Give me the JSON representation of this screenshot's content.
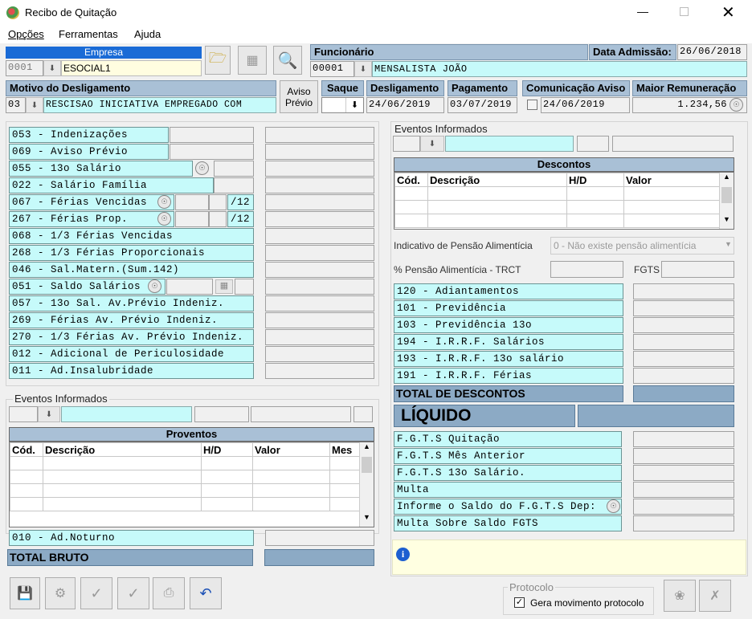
{
  "window": {
    "title": "Recibo de Quitação"
  },
  "menu": [
    "Opções",
    "Ferramentas",
    "Ajuda"
  ],
  "empresa": {
    "label": "Empresa",
    "code": "0001",
    "name": "ESOCIAL1"
  },
  "funcionario": {
    "label": "Funcionário",
    "code": "00001",
    "name": "MENSALISTA JOÃO"
  },
  "admissao": {
    "label": "Data Admissão:",
    "value": "26/06/2018"
  },
  "motivo": {
    "label": "Motivo do Desligamento",
    "code": "03",
    "value": "RESCISAO INICIATIVA EMPREGADO COM"
  },
  "aviso_previo": {
    "line1": "Aviso",
    "line2": "Prévio"
  },
  "saque": {
    "label": "Saque"
  },
  "desligamento": {
    "label": "Desligamento",
    "value": "24/06/2019"
  },
  "pagamento": {
    "label": "Pagamento",
    "value": "03/07/2019"
  },
  "comunicacao": {
    "label": "Comunicação Aviso",
    "value": "24/06/2019"
  },
  "maior_rem": {
    "label": "Maior Remuneração",
    "value": "1.234,56"
  },
  "left_events": [
    {
      "text": "053 - Indenizações"
    },
    {
      "text": "069 - Aviso Prévio"
    },
    {
      "text": "055 - 13o Salário"
    },
    {
      "text": "022 - Salário Família"
    },
    {
      "text": "067 - Férias Vencidas",
      "suffix": "/12"
    },
    {
      "text": "267 - Férias Prop.",
      "suffix": "/12"
    },
    {
      "text": "068 - 1/3 Férias Vencidas"
    },
    {
      "text": "268 - 1/3 Férias Proporcionais"
    },
    {
      "text": "046 - Sal.Matern.(Sum.142)"
    },
    {
      "text": "051 - Saldo Salários"
    },
    {
      "text": "057 - 13o Sal. Av.Prévio Indeniz."
    },
    {
      "text": "269 -  Férias  Av. Prévio Indeniz."
    },
    {
      "text": "270 - 1/3 Férias Av. Prévio Indeniz."
    },
    {
      "text": "012 - Adicional de Periculosidade"
    },
    {
      "text": "011 - Ad.Insalubridade"
    }
  ],
  "eventos_informados_label": "Eventos Informados",
  "proventos": {
    "title": "Proventos",
    "cols": [
      "Cód.",
      "Descrição",
      "H/D",
      "Valor",
      "Mes"
    ]
  },
  "ad_noturno": "010 - Ad.Noturno",
  "total_bruto": "TOTAL BRUTO",
  "descontos": {
    "title": "Descontos",
    "cols": [
      "Cód.",
      "Descrição",
      "H/D",
      "Valor"
    ]
  },
  "pensao": {
    "label": "Indicativo de Pensão Alimentícia",
    "value": "0 - Não existe pensão alimentícia"
  },
  "pct_pensao": {
    "label": "% Pensão Alimentícia - TRCT"
  },
  "fgts_label": "FGTS",
  "desc_events": [
    "120 - Adiantamentos",
    "101 - Previdência",
    "103 - Previdência 13o",
    "194 - I.R.R.F. Salários",
    "193 - I.R.R.F. 13o salário",
    "191 - I.R.R.F. Férias"
  ],
  "total_descontos": "TOTAL DE DESCONTOS",
  "liquido": "LÍQUIDO",
  "fgts_events": [
    "F.G.T.S  Quitação",
    "F.G.T.S  Mês Anterior",
    "F.G.T.S  13o Salário.",
    "Multa",
    "Informe o Saldo do F.G.T.S Dep:",
    "Multa Sobre Saldo FGTS"
  ],
  "protocolo": {
    "label": "Protocolo",
    "checkbox": "Gera movimento protocolo"
  },
  "colors": {
    "cyan": "#c6fafa",
    "steel": "#a9c0d6",
    "info_bg": "#ffffe1"
  }
}
